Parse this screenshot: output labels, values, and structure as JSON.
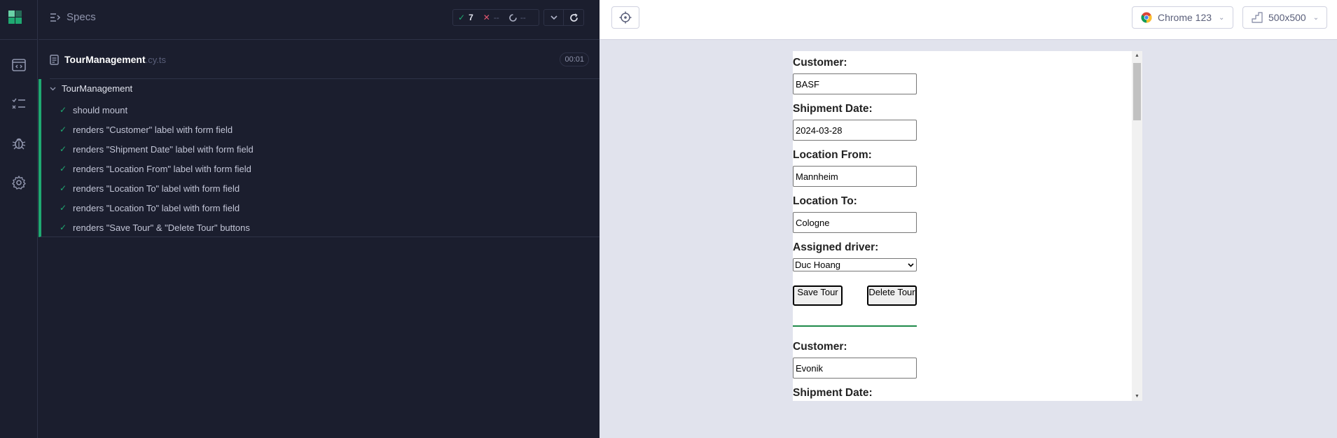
{
  "rail": {
    "icons": [
      "cypress-logo-icon",
      "specs-list-icon",
      "runs-icon",
      "debug-icon",
      "settings-icon"
    ]
  },
  "reporter": {
    "specs_label": "Specs",
    "stats": {
      "passed": "7",
      "failed": "--",
      "pending": "--"
    },
    "spec": {
      "name": "TourManagement",
      "ext": ".cy.ts",
      "duration": "00:01"
    },
    "suite": {
      "title": "TourManagement",
      "tests": [
        "should mount",
        "renders \"Customer\" label with form field",
        "renders \"Shipment Date\" label with form field",
        "renders \"Location From\" label with form field",
        "renders \"Location To\" label with form field",
        "renders \"Location To\" label with form field",
        "renders \"Save Tour\" & \"Delete Tour\" buttons"
      ]
    }
  },
  "aut": {
    "browser": "Chrome 123",
    "viewport": "500x500",
    "form1": {
      "customer_label": "Customer:",
      "customer_value": "BASF",
      "date_label": "Shipment Date:",
      "date_value": "2024-03-28",
      "from_label": "Location From:",
      "from_value": "Mannheim",
      "to_label": "Location To:",
      "to_value": "Cologne",
      "driver_label": "Assigned driver:",
      "driver_value": "Duc Hoang",
      "save_label": "Save Tour",
      "delete_label": "Delete Tour"
    },
    "form2": {
      "customer_label": "Customer:",
      "customer_value": "Evonik",
      "date_label": "Shipment Date:"
    }
  },
  "colors": {
    "pass": "#1fa971",
    "fail": "#e45770",
    "sidebar_bg": "#1b1e2e",
    "aut_bg": "#e1e3ed",
    "divider_green": "#1f8a4a"
  }
}
